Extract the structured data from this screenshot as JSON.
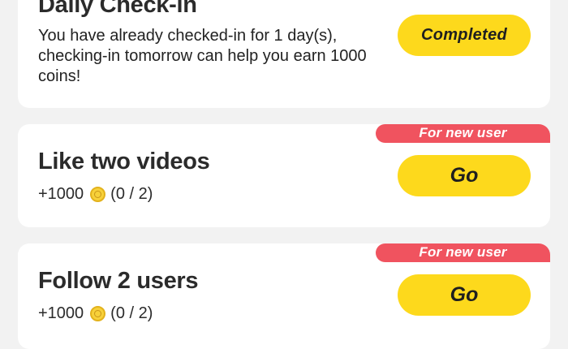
{
  "checkin": {
    "title": "Daily Check-in",
    "description": "You have already checked-in for 1 day(s), checking-in tomorrow can help you earn 1000 coins!",
    "button_label": "Completed"
  },
  "tasks": [
    {
      "title": "Like two videos",
      "tag": "For new user",
      "reward": "+1000",
      "progress": "(0 / 2)",
      "button_label": "Go"
    },
    {
      "title": "Follow 2 users",
      "tag": "For new user",
      "reward": "+1000",
      "progress": "(0 / 2)",
      "button_label": "Go"
    }
  ],
  "colors": {
    "button": "#fdd91c",
    "tag": "#f0535f",
    "coin": "#f7d13a"
  },
  "icons": {
    "coin": "coin-icon"
  }
}
